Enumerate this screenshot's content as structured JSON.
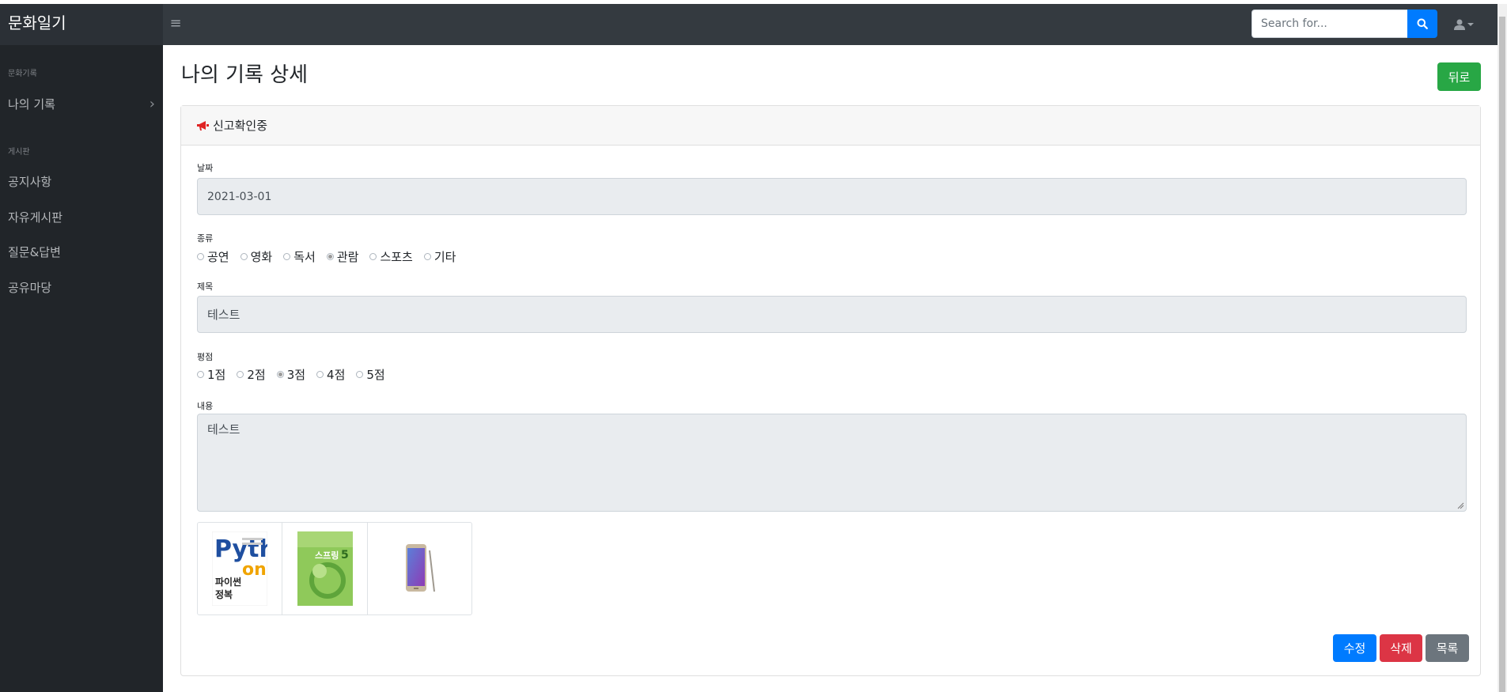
{
  "app": {
    "brand": "문화일기"
  },
  "navbar": {
    "search_placeholder": "Search for..."
  },
  "sidebar": {
    "sections": [
      {
        "heading": "문화기록",
        "items": [
          {
            "label": "나의 기록",
            "chevron": "›"
          }
        ]
      },
      {
        "heading": "게시판",
        "items": [
          {
            "label": "공지사항"
          },
          {
            "label": "자유게시판"
          },
          {
            "label": "질문&답변"
          },
          {
            "label": "공유마당"
          }
        ]
      }
    ]
  },
  "page": {
    "title": "나의 기록 상세",
    "back_label": "뒤로"
  },
  "card": {
    "header": "신고확인중",
    "date": {
      "label": "날짜",
      "value": "2021-03-01"
    },
    "category": {
      "label": "종류",
      "options": [
        "공연",
        "영화",
        "독서",
        "관람",
        "스포츠",
        "기타"
      ],
      "selected": "관람"
    },
    "title": {
      "label": "제목",
      "value": "테스트"
    },
    "rating": {
      "label": "평점",
      "options": [
        "1점",
        "2점",
        "3점",
        "4점",
        "5점"
      ],
      "selected": "3점"
    },
    "content": {
      "label": "내용",
      "value": "테스트"
    },
    "images": [
      {
        "name": "python-book-cover",
        "text_lines": [
          "Pyth",
          "on",
          "파이썬",
          "정복"
        ]
      },
      {
        "name": "spring-book-cover",
        "text_lines": [
          "스프링",
          "5"
        ]
      },
      {
        "name": "smartphone-image",
        "text_lines": []
      }
    ],
    "actions": {
      "edit": "수정",
      "delete": "삭제",
      "list": "목록"
    }
  },
  "colors": {
    "navbar": "#343a40",
    "sidebar": "#212529",
    "primary": "#007bff",
    "success": "#28a745",
    "danger": "#dc3545",
    "secondary": "#6c757d",
    "megaphone": "#e02424"
  }
}
